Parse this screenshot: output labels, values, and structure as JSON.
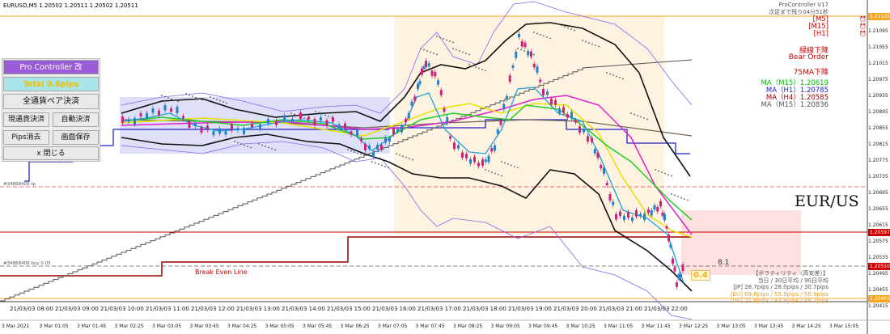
{
  "symbol_header": "EURUSD,M5  1.20502 1.20511 1.20502 1.20511",
  "top_right": {
    "timer_line1": "ProController V17",
    "timer_line2": "次足まで残り04分51秒",
    "tf_m5": "[M5]",
    "tf_m15": "[M15]",
    "tf_h1": "[H1]"
  },
  "signals": {
    "trend_down": "緑線下降",
    "bear_order": "Bear Order",
    "ma75_down": "75MA下降"
  },
  "ma_info": [
    {
      "label": "MA（M15）1.20619",
      "color": "#00bb00"
    },
    {
      "label": "MA（H1）1.20785",
      "color": "#2222cc"
    },
    {
      "label": "MA（H4）1.20585",
      "color": "#990000"
    },
    {
      "label": "MA（M15）1.20836",
      "color": "#555555"
    }
  ],
  "panel": {
    "title": "Pro Controller 改",
    "total": "Total  0.6pips",
    "all_close": "全通貨ペア決済",
    "current_close": "現通貨決済",
    "auto_close": "自動決済",
    "pips_clear": "Pips消去",
    "screen_save": "画面保存",
    "close": "x 閉じる"
  },
  "chart_labels": {
    "pair": "EUR/US",
    "break_even": "Break Even Line",
    "value_box": "8.1",
    "pips_tag": "0.4",
    "order_tp": "#34868406 tp",
    "order_buy": "#34868406 buy 0.05"
  },
  "volatility": {
    "title": "【ボラティリティ（高安差）】",
    "sub": "当日 / 30日平均 / 90日平均",
    "rows": [
      {
        "text": "[JP] 28.7pips / 28.0pips / 30.7pips",
        "color": "#555555"
      },
      {
        "text": "[EU] 69.6pips / 55.5pips / 56.9pips",
        "color": "#e8a030"
      },
      {
        "text": "[US] 21.8pips / 43.9pips / 48.7pips",
        "color": "#e8a030"
      }
    ]
  },
  "price_axis": [
    "1.21095",
    "1.21055",
    "1.21015",
    "1.20975",
    "1.20935",
    "1.20895",
    "1.20855",
    "1.20815",
    "1.20775",
    "1.20735",
    "1.20695",
    "1.20655",
    "1.20615",
    "1.20575",
    "1.20535",
    "1.20495",
    "1.20455",
    "1.20415"
  ],
  "price_tags": [
    {
      "text": "1.21125",
      "color": "#f5a623"
    },
    {
      "text": "1.20597",
      "color": "#cc0000"
    },
    {
      "text": "1.20510",
      "color": "#cc0000"
    },
    {
      "text": "1.20403",
      "color": "#f5a623"
    }
  ],
  "time_axis": [
    "21/03/03 08:00",
    "21/03/03 09:00",
    "21/03/03 10:00",
    "21/03/03 11:00",
    "21/03/03 12:00",
    "21/03/03 13:00",
    "21/03/03 14:00",
    "21/03/03 15:00",
    "21/03/03 16:00",
    "21/03/03 17:00",
    "21/03/03 18:00",
    "21/03/03 19:00",
    "21/03/03 20:00",
    "21/03/03 21:00",
    "21/03/03 22:00"
  ],
  "bottom_axis": [
    "3 Mar 2021",
    "3 Mar 01:05",
    "3 Mar 01:45",
    "3 Mar 02:25",
    "3 Mar 03:05",
    "3 Mar 03:45",
    "3 Mar 04:25",
    "3 Mar 05:05",
    "3 Mar 05:45",
    "3 Mar 06:25",
    "3 Mar 07:05",
    "3 Mar 07:45",
    "3 Mar 08:25",
    "3 Mar 09:05",
    "3 Mar 09:45",
    "3 Mar 10:25",
    "3 Mar 11:05",
    "3 Mar 11:45",
    "3 Mar 12:25",
    "3 Mar 13:05",
    "3 Mar 13:45",
    "3 Mar 14:25",
    "3 Mar 15:05"
  ],
  "colors": {
    "bull_candle": "#2a80c8",
    "bear_candle": "#cc2277",
    "asia_box": "#dde0f8",
    "london_box": "#fdf3e0",
    "target_box": "#fde0e0"
  }
}
